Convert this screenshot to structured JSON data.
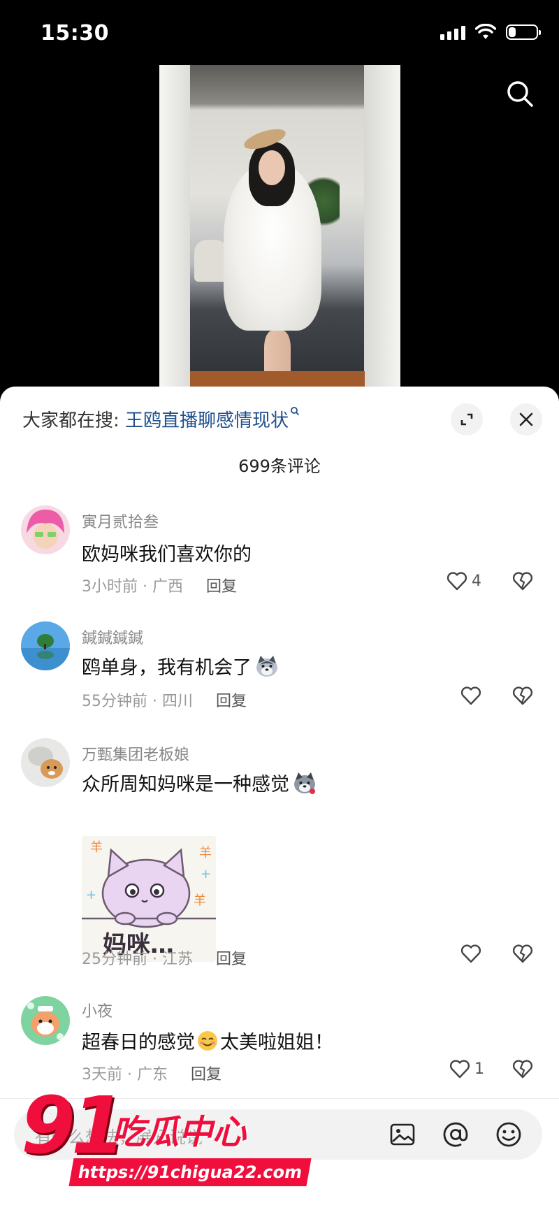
{
  "status_bar": {
    "time": "15:30",
    "battery_level": 0.25
  },
  "comments_sheet": {
    "hot_search_prefix": "大家都在搜:",
    "hot_search_term": "王鸥直播聊感情现状",
    "comment_count": "699条评论",
    "comments": [
      {
        "username": "寅月贰拾叁",
        "text": "欧妈咪我们喜欢你的",
        "time_location": "3小时前 · 广西",
        "reply": "回复",
        "likes": "4"
      },
      {
        "username": "鍼鍼鍼鍼",
        "text": "鸥单身，我有机会了",
        "time_location": "55分钟前 · 四川",
        "reply": "回复",
        "likes": ""
      },
      {
        "username": "万甄集团老板娘",
        "text": "众所周知妈咪是一种感觉",
        "sticker_text": "妈咪…",
        "time_location": "25分钟前 · 江苏",
        "reply": "回复",
        "likes": ""
      },
      {
        "username": "小夜",
        "text_before": "超春日的感觉",
        "text_after": "太美啦姐姐！",
        "time_location": "3天前 · 广东",
        "reply": "回复",
        "likes": "1"
      }
    ],
    "input_placeholder": "有什么想法，展开说说"
  },
  "watermark": {
    "number": "91",
    "title": "吃瓜中心",
    "url": "https://91chigua22.com"
  },
  "colors": {
    "hot_term": "#1e4f8c",
    "watermark_red": "#f00f3c",
    "sheet_bg": "#ffffff"
  },
  "icons": [
    "search-icon",
    "expand-icon",
    "close-icon",
    "heart-icon",
    "broken-heart-icon",
    "image-icon",
    "at-icon",
    "emoji-icon"
  ]
}
